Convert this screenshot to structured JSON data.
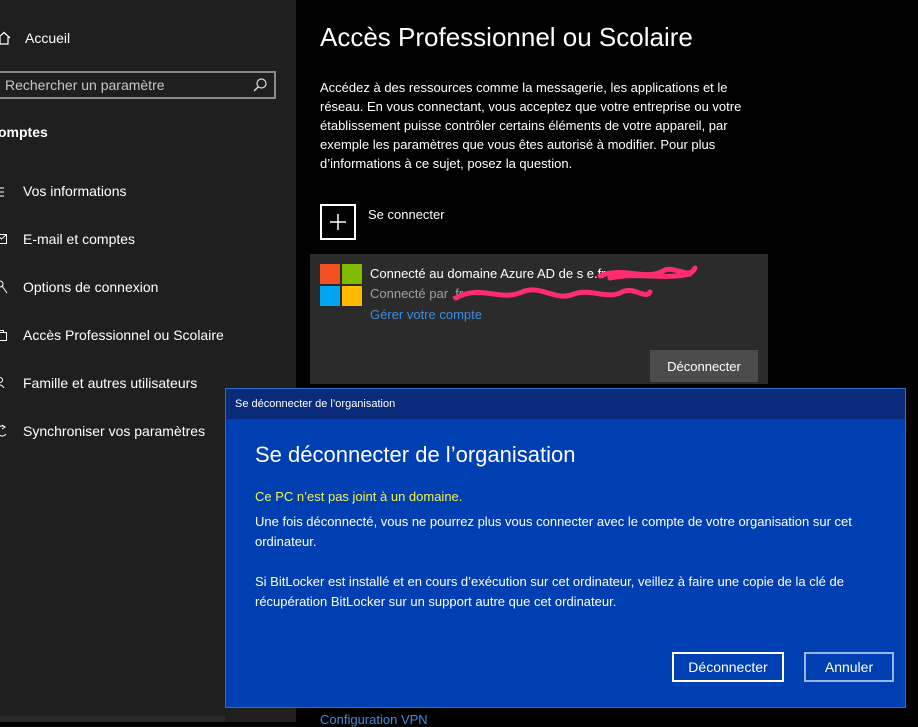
{
  "sidebar": {
    "home_label": "Accueil",
    "search_placeholder": "Rechercher un paramètre",
    "section_title": "omptes",
    "items": [
      {
        "label": "Vos informations",
        "icon": "person-icon"
      },
      {
        "label": "E-mail et comptes",
        "icon": "mail-icon"
      },
      {
        "label": "Options de connexion",
        "icon": "key-icon"
      },
      {
        "label": "Accès Professionnel ou Scolaire",
        "icon": "briefcase-icon"
      },
      {
        "label": "Famille et autres utilisateurs",
        "icon": "people-icon"
      },
      {
        "label": "Synchroniser vos paramètres",
        "icon": "sync-icon"
      }
    ]
  },
  "main": {
    "title": "Accès Professionnel ou Scolaire",
    "description": "Accédez à des ressources comme la messagerie, les applications et le réseau. En vous connectant, vous acceptez que votre entreprise ou votre établissement puisse contrôler certains éléments de votre appareil, par exemple les paramètres que vous êtes autorisé à modifier. Pour plus d’informations à ce sujet, posez la question.",
    "connect_label": "Se connecter",
    "account": {
      "title": "Connecté au domaine Azure AD de s                        e.fr",
      "subtitle": "Connecté par                                              .fr",
      "manage_link": "Gérer votre compte",
      "disconnect_label": "Déconnecter"
    },
    "footer_link": "Configuration VPN"
  },
  "dialog": {
    "titlebar": "Se déconnecter de l’organisation",
    "heading": "Se déconnecter de l’organisation",
    "warning": "Ce PC n’est pas joint à un domaine.",
    "paragraph1": "Une fois déconnecté, vous ne pourrez plus vous connecter avec le compte de votre organisation sur cet ordinateur.",
    "paragraph2": "Si BitLocker est installé et en cours d’exécution sur cet ordinateur, veillez à faire une copie de la clé de récupération BitLocker sur un support autre que cet ordinateur.",
    "confirm_label": "Déconnecter",
    "cancel_label": "Annuler"
  },
  "colors": {
    "sidebar_bg": "#1f1f1f",
    "dialog_bg": "#003fb2",
    "dialog_titlebar": "#0a2a7a",
    "warning_text": "#f2f254",
    "link": "#3a8dde",
    "scribble": "#ff2d6f"
  }
}
